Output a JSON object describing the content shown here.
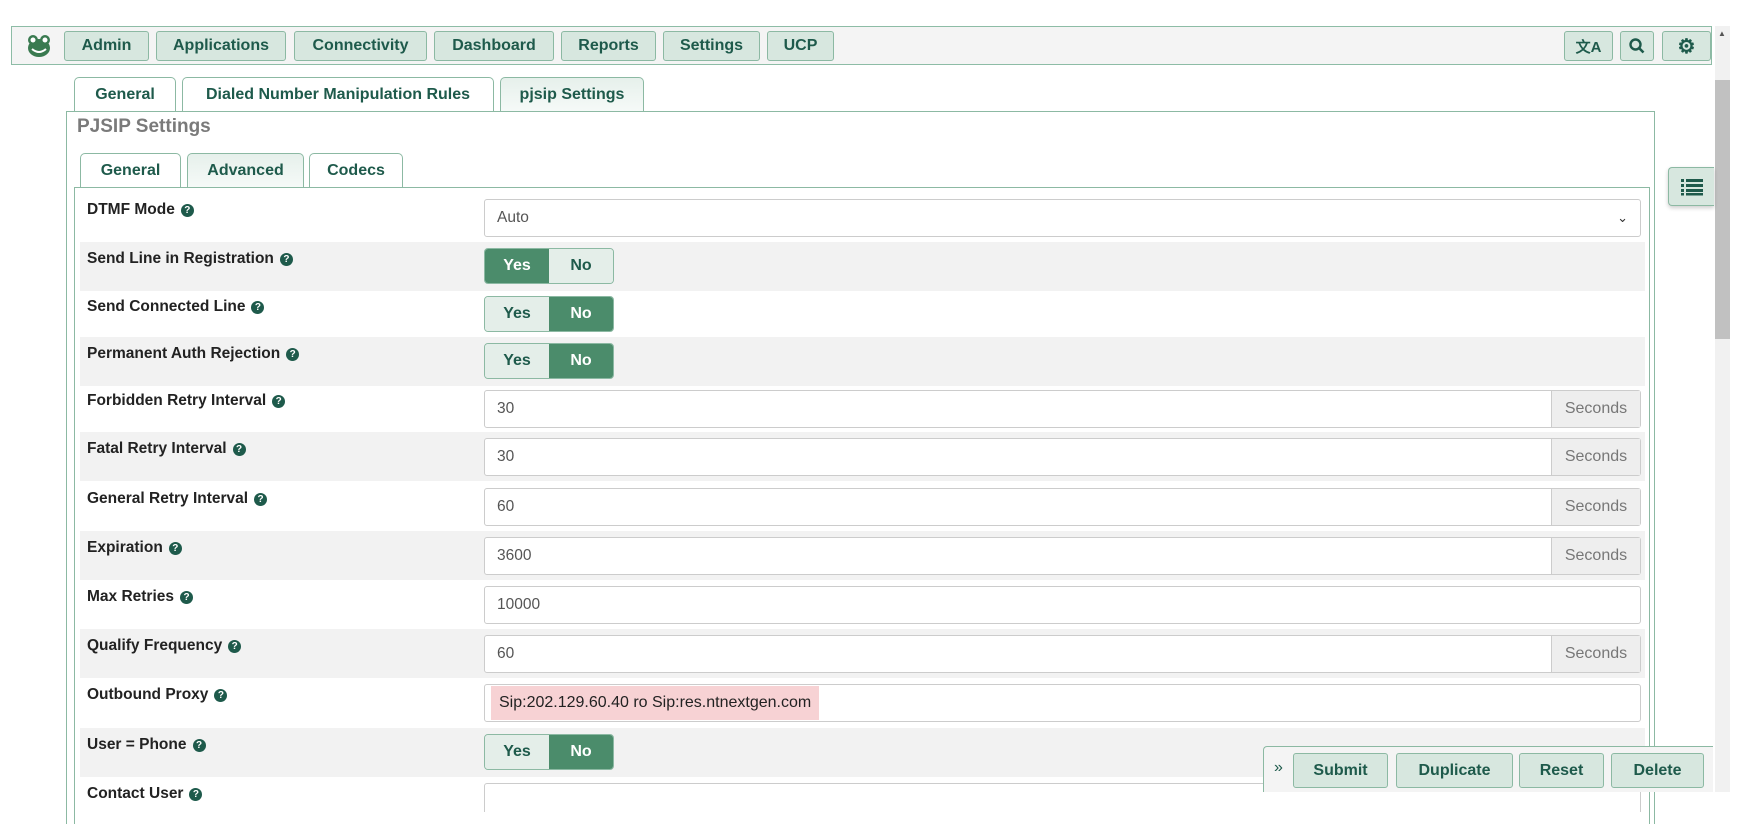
{
  "nav": {
    "items": [
      "Admin",
      "Applications",
      "Connectivity",
      "Dashboard",
      "Reports",
      "Settings",
      "UCP"
    ],
    "right_icons": [
      "translate-icon",
      "search-icon",
      "gear-icon"
    ]
  },
  "tabs": {
    "items": [
      "General",
      "Dialed Number Manipulation Rules",
      "pjsip Settings"
    ],
    "active": "pjsip Settings"
  },
  "section_title": "PJSIP Settings",
  "subtabs": {
    "items": [
      "General",
      "Advanced",
      "Codecs"
    ],
    "active": "Advanced"
  },
  "form": {
    "dtmf_mode": {
      "label": "DTMF Mode",
      "value": "Auto"
    },
    "send_line": {
      "label": "Send Line in Registration",
      "yes": "Yes",
      "no": "No",
      "selected": "Yes"
    },
    "send_connected": {
      "label": "Send Connected Line",
      "yes": "Yes",
      "no": "No",
      "selected": "No"
    },
    "perm_auth": {
      "label": "Permanent Auth Rejection",
      "yes": "Yes",
      "no": "No",
      "selected": "No"
    },
    "forbidden_retry": {
      "label": "Forbidden Retry Interval",
      "value": "30",
      "unit": "Seconds"
    },
    "fatal_retry": {
      "label": "Fatal Retry Interval",
      "value": "30",
      "unit": "Seconds"
    },
    "general_retry": {
      "label": "General Retry Interval",
      "value": "60",
      "unit": "Seconds"
    },
    "expiration": {
      "label": "Expiration",
      "value": "3600",
      "unit": "Seconds"
    },
    "max_retries": {
      "label": "Max Retries",
      "value": "10000"
    },
    "qualify": {
      "label": "Qualify Frequency",
      "value": "60",
      "unit": "Seconds"
    },
    "outbound_proxy": {
      "label": "Outbound Proxy",
      "value": "Sip:202.129.60.40 ro Sip:res.ntnextgen.com"
    },
    "user_phone": {
      "label": "User = Phone",
      "yes": "Yes",
      "no": "No",
      "selected": "No"
    },
    "contact_user": {
      "label": "Contact User"
    }
  },
  "actions": {
    "expand": "»",
    "submit": "Submit",
    "duplicate": "Duplicate",
    "reset": "Reset",
    "delete": "Delete"
  },
  "colors": {
    "accent": "#4b8c6b",
    "button_bg": "#d7e7df",
    "text": "#1e5a4b",
    "highlight": "#f7d2d4"
  }
}
